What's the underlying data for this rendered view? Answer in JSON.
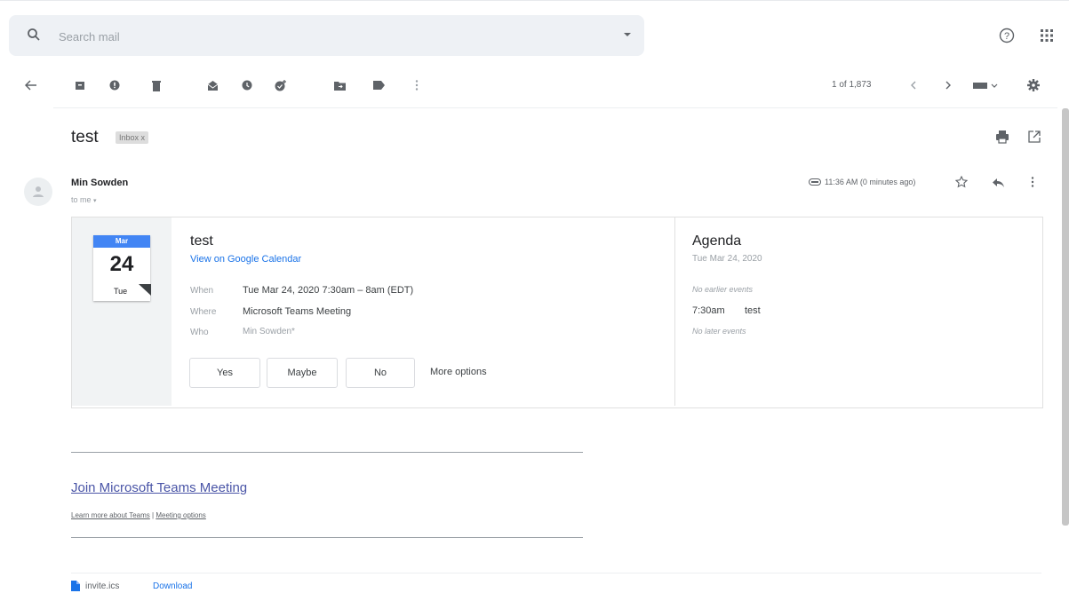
{
  "search": {
    "placeholder": "Search mail"
  },
  "toolbar": {
    "pager": "1 of 1,873",
    "icons": [
      "back-arrow-icon",
      "archive-icon",
      "report-spam-icon",
      "delete-icon",
      "mark-unread-icon",
      "snooze-icon",
      "add-task-icon",
      "move-to-icon",
      "labels-icon",
      "more-vert-icon",
      "newer-icon",
      "older-icon",
      "input-tools-icon",
      "settings-icon"
    ]
  },
  "message": {
    "subject": "test",
    "label": "Inbox x",
    "sender": "Min Sowden",
    "to": "to me",
    "time": "11:36 AM (0 minutes ago)"
  },
  "event": {
    "cal_month": "Mar",
    "cal_day": "24",
    "cal_dow": "Tue",
    "title": "test",
    "calendar_link": "View on Google Calendar",
    "when_label": "When",
    "when": "Tue Mar 24, 2020 7:30am – 8am (EDT)",
    "where_label": "Where",
    "where": "Microsoft Teams Meeting",
    "who_label": "Who",
    "who": "Min Sowden*",
    "rsvp": {
      "yes": "Yes",
      "maybe": "Maybe",
      "no": "No",
      "more": "More options"
    }
  },
  "agenda": {
    "title": "Agenda",
    "date": "Tue Mar 24, 2020",
    "no_earlier": "No earlier events",
    "item_time": "7:30am",
    "item_title": "test",
    "no_later": "No later events"
  },
  "teams": {
    "join": "Join Microsoft Teams Meeting",
    "learn_more": "Learn more about Teams",
    "separator": " | ",
    "meeting_options": "Meeting options"
  },
  "attachment": {
    "name": "invite.ics",
    "download": "Download"
  },
  "colors": {
    "link_blue": "#1a73e8",
    "calendar_blue": "#4285f4",
    "teams_link": "#4a55a7"
  }
}
